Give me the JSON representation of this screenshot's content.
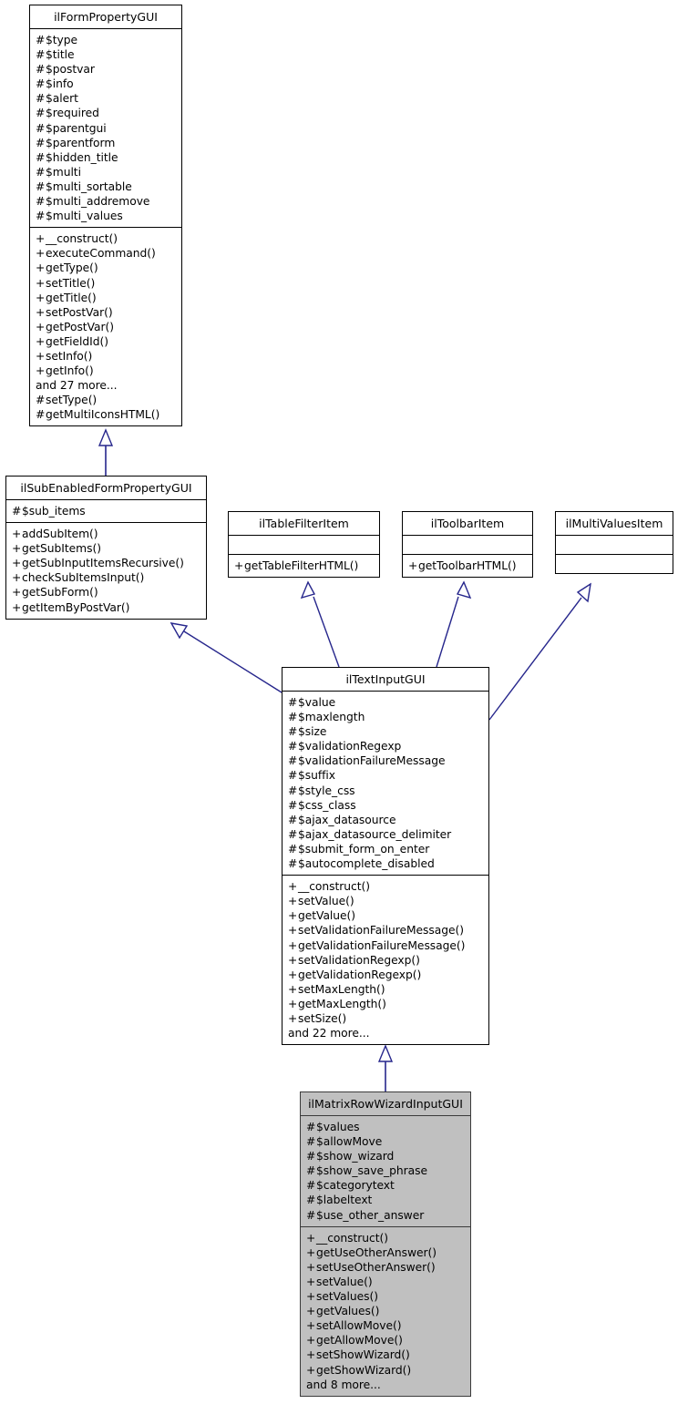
{
  "diagram": {
    "kind": "uml-class-inheritance-diagram",
    "edge_color": "#26268c",
    "shaded_fill": "#c0c0c0",
    "box_fill": "#ffffff",
    "border_color": "#000000"
  },
  "classes": {
    "ilFormPropertyGUI": {
      "name": "ilFormPropertyGUI",
      "highlighted": false,
      "attributes": [
        {
          "vis": "#",
          "text": "$type"
        },
        {
          "vis": "#",
          "text": "$title"
        },
        {
          "vis": "#",
          "text": "$postvar"
        },
        {
          "vis": "#",
          "text": "$info"
        },
        {
          "vis": "#",
          "text": "$alert"
        },
        {
          "vis": "#",
          "text": "$required"
        },
        {
          "vis": "#",
          "text": "$parentgui"
        },
        {
          "vis": "#",
          "text": "$parentform"
        },
        {
          "vis": "#",
          "text": "$hidden_title"
        },
        {
          "vis": "#",
          "text": "$multi"
        },
        {
          "vis": "#",
          "text": "$multi_sortable"
        },
        {
          "vis": "#",
          "text": "$multi_addremove"
        },
        {
          "vis": "#",
          "text": "$multi_values"
        }
      ],
      "methods": [
        {
          "vis": "+",
          "text": "__construct()"
        },
        {
          "vis": "+",
          "text": "executeCommand()"
        },
        {
          "vis": "+",
          "text": "getType()"
        },
        {
          "vis": "+",
          "text": "setTitle()"
        },
        {
          "vis": "+",
          "text": "getTitle()"
        },
        {
          "vis": "+",
          "text": "setPostVar()"
        },
        {
          "vis": "+",
          "text": "getPostVar()"
        },
        {
          "vis": "+",
          "text": "getFieldId()"
        },
        {
          "vis": "+",
          "text": "setInfo()"
        },
        {
          "vis": "+",
          "text": "getInfo()"
        },
        {
          "vis": "",
          "text": "and 27 more..."
        },
        {
          "vis": "#",
          "text": "setType()"
        },
        {
          "vis": "#",
          "text": "getMultiIconsHTML()"
        }
      ]
    },
    "ilSubEnabledFormPropertyGUI": {
      "name": "ilSubEnabledFormPropertyGUI",
      "highlighted": false,
      "attributes": [
        {
          "vis": "#",
          "text": "$sub_items"
        }
      ],
      "methods": [
        {
          "vis": "+",
          "text": "addSubItem()"
        },
        {
          "vis": "+",
          "text": "getSubItems()"
        },
        {
          "vis": "+",
          "text": "getSubInputItemsRecursive()"
        },
        {
          "vis": "+",
          "text": "checkSubItemsInput()"
        },
        {
          "vis": "+",
          "text": "getSubForm()"
        },
        {
          "vis": "+",
          "text": "getItemByPostVar()"
        }
      ]
    },
    "ilTableFilterItem": {
      "name": "ilTableFilterItem",
      "highlighted": false,
      "attributes": [],
      "methods": [
        {
          "vis": "+",
          "text": "getTableFilterHTML()"
        }
      ]
    },
    "ilToolbarItem": {
      "name": "ilToolbarItem",
      "highlighted": false,
      "attributes": [],
      "methods": [
        {
          "vis": "+",
          "text": "getToolbarHTML()"
        }
      ]
    },
    "ilMultiValuesItem": {
      "name": "ilMultiValuesItem",
      "highlighted": false,
      "attributes": [],
      "methods": []
    },
    "ilTextInputGUI": {
      "name": "ilTextInputGUI",
      "highlighted": false,
      "attributes": [
        {
          "vis": "#",
          "text": "$value"
        },
        {
          "vis": "#",
          "text": "$maxlength"
        },
        {
          "vis": "#",
          "text": "$size"
        },
        {
          "vis": "#",
          "text": "$validationRegexp"
        },
        {
          "vis": "#",
          "text": "$validationFailureMessage"
        },
        {
          "vis": "#",
          "text": "$suffix"
        },
        {
          "vis": "#",
          "text": "$style_css"
        },
        {
          "vis": "#",
          "text": "$css_class"
        },
        {
          "vis": "#",
          "text": "$ajax_datasource"
        },
        {
          "vis": "#",
          "text": "$ajax_datasource_delimiter"
        },
        {
          "vis": "#",
          "text": "$submit_form_on_enter"
        },
        {
          "vis": "#",
          "text": "$autocomplete_disabled"
        }
      ],
      "methods": [
        {
          "vis": "+",
          "text": "__construct()"
        },
        {
          "vis": "+",
          "text": "setValue()"
        },
        {
          "vis": "+",
          "text": "getValue()"
        },
        {
          "vis": "+",
          "text": "setValidationFailureMessage()"
        },
        {
          "vis": "+",
          "text": "getValidationFailureMessage()"
        },
        {
          "vis": "+",
          "text": "setValidationRegexp()"
        },
        {
          "vis": "+",
          "text": "getValidationRegexp()"
        },
        {
          "vis": "+",
          "text": "setMaxLength()"
        },
        {
          "vis": "+",
          "text": "getMaxLength()"
        },
        {
          "vis": "+",
          "text": "setSize()"
        },
        {
          "vis": "",
          "text": "and 22 more..."
        }
      ]
    },
    "ilMatrixRowWizardInputGUI": {
      "name": "ilMatrixRowWizardInputGUI",
      "highlighted": true,
      "attributes": [
        {
          "vis": "#",
          "text": "$values"
        },
        {
          "vis": "#",
          "text": "$allowMove"
        },
        {
          "vis": "#",
          "text": "$show_wizard"
        },
        {
          "vis": "#",
          "text": "$show_save_phrase"
        },
        {
          "vis": "#",
          "text": "$categorytext"
        },
        {
          "vis": "#",
          "text": "$labeltext"
        },
        {
          "vis": "#",
          "text": "$use_other_answer"
        }
      ],
      "methods": [
        {
          "vis": "+",
          "text": "__construct()"
        },
        {
          "vis": "+",
          "text": "getUseOtherAnswer()"
        },
        {
          "vis": "+",
          "text": "setUseOtherAnswer()"
        },
        {
          "vis": "+",
          "text": "setValue()"
        },
        {
          "vis": "+",
          "text": "setValues()"
        },
        {
          "vis": "+",
          "text": "getValues()"
        },
        {
          "vis": "+",
          "text": "setAllowMove()"
        },
        {
          "vis": "+",
          "text": "getAllowMove()"
        },
        {
          "vis": "+",
          "text": "setShowWizard()"
        },
        {
          "vis": "+",
          "text": "getShowWizard()"
        },
        {
          "vis": "",
          "text": "and 8 more..."
        }
      ]
    }
  },
  "relations": [
    {
      "from": "ilSubEnabledFormPropertyGUI",
      "to": "ilFormPropertyGUI",
      "type": "generalization"
    },
    {
      "from": "ilTextInputGUI",
      "to": "ilSubEnabledFormPropertyGUI",
      "type": "generalization"
    },
    {
      "from": "ilTextInputGUI",
      "to": "ilTableFilterItem",
      "type": "generalization"
    },
    {
      "from": "ilTextInputGUI",
      "to": "ilToolbarItem",
      "type": "generalization"
    },
    {
      "from": "ilTextInputGUI",
      "to": "ilMultiValuesItem",
      "type": "generalization"
    },
    {
      "from": "ilMatrixRowWizardInputGUI",
      "to": "ilTextInputGUI",
      "type": "generalization"
    }
  ]
}
